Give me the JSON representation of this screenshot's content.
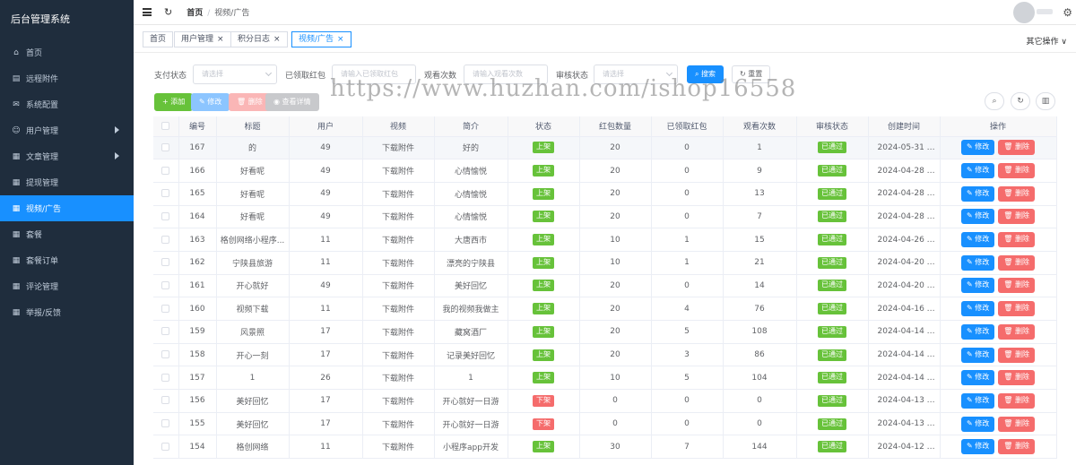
{
  "app": {
    "title": "后台管理系统"
  },
  "sidebar": {
    "items": [
      {
        "label": "首页",
        "icon": "home-icon",
        "arrow": false,
        "active": false
      },
      {
        "label": "远程附件",
        "icon": "file-icon",
        "arrow": false,
        "active": false
      },
      {
        "label": "系统配置",
        "icon": "chat-icon",
        "arrow": false,
        "active": false
      },
      {
        "label": "用户管理",
        "icon": "user-icon",
        "arrow": true,
        "active": false
      },
      {
        "label": "文章管理",
        "icon": "document-icon",
        "arrow": true,
        "active": false
      },
      {
        "label": "提现管理",
        "icon": "grid-icon",
        "arrow": false,
        "active": false
      },
      {
        "label": "视频/广告",
        "icon": "grid-icon",
        "arrow": false,
        "active": true
      },
      {
        "label": "套餐",
        "icon": "grid-icon",
        "arrow": false,
        "active": false
      },
      {
        "label": "套餐订单",
        "icon": "grid-icon",
        "arrow": false,
        "active": false
      },
      {
        "label": "评论管理",
        "icon": "grid-icon",
        "arrow": false,
        "active": false
      },
      {
        "label": "举报/反馈",
        "icon": "grid-icon",
        "arrow": false,
        "active": false
      }
    ]
  },
  "header": {
    "breadcrumb_home": "首页",
    "breadcrumb_sep": "/",
    "breadcrumb_current": "视频/广告"
  },
  "tags": [
    {
      "label": "首页",
      "closable": false,
      "active": false
    },
    {
      "label": "用户管理",
      "closable": true,
      "active": false
    },
    {
      "label": "积分日志",
      "closable": true,
      "active": false
    },
    {
      "label": "视频/广告",
      "closable": true,
      "active": true
    }
  ],
  "tags_other_ops": "其它操作 ∨",
  "search": {
    "pay_status_label": "支付状态",
    "pay_status_placeholder": "请选择",
    "redpacket_label": "已领取红包",
    "redpacket_placeholder": "请输入已领取红包",
    "views_label": "观看次数",
    "views_placeholder": "请输入观看次数",
    "audit_label": "审核状态",
    "audit_placeholder": "请选择",
    "search_btn": "搜索",
    "reset_btn": "重置"
  },
  "toolbar": {
    "add": "+ 添加",
    "edit": "修改",
    "delete": "删除",
    "detail": "查看详情"
  },
  "table": {
    "headers": [
      "",
      "编号",
      "标题",
      "用户",
      "视频",
      "简介",
      "状态",
      "红包数量",
      "已领取红包",
      "观看次数",
      "审核状态",
      "创建时间",
      "操作"
    ],
    "edit_label": "修改",
    "delete_label": "删除",
    "rows": [
      {
        "id": "167",
        "title": "的",
        "user": "49",
        "video": "下载附件",
        "intro": "好的",
        "status": "上架",
        "packets": "20",
        "received": "0",
        "views": "1",
        "audit": "已通过",
        "created": "2024-05-31 15:..."
      },
      {
        "id": "166",
        "title": "好看呢",
        "user": "49",
        "video": "下载附件",
        "intro": "心情愉悦",
        "status": "上架",
        "packets": "20",
        "received": "0",
        "views": "9",
        "audit": "已通过",
        "created": "2024-04-28 18:..."
      },
      {
        "id": "165",
        "title": "好看呢",
        "user": "49",
        "video": "下载附件",
        "intro": "心情愉悦",
        "status": "上架",
        "packets": "20",
        "received": "0",
        "views": "13",
        "audit": "已通过",
        "created": "2024-04-28 18:..."
      },
      {
        "id": "164",
        "title": "好看呢",
        "user": "49",
        "video": "下载附件",
        "intro": "心情愉悦",
        "status": "上架",
        "packets": "20",
        "received": "0",
        "views": "7",
        "audit": "已通过",
        "created": "2024-04-28 18:..."
      },
      {
        "id": "163",
        "title": "格创网络小程序...",
        "user": "11",
        "video": "下载附件",
        "intro": "大唐西市",
        "status": "上架",
        "packets": "10",
        "received": "1",
        "views": "15",
        "audit": "已通过",
        "created": "2024-04-26 00:..."
      },
      {
        "id": "162",
        "title": "宁陕县旅游",
        "user": "11",
        "video": "下载附件",
        "intro": "漂亮的宁陕县",
        "status": "上架",
        "packets": "10",
        "received": "1",
        "views": "21",
        "audit": "已通过",
        "created": "2024-04-20 22:..."
      },
      {
        "id": "161",
        "title": "开心就好",
        "user": "49",
        "video": "下载附件",
        "intro": "美好回忆",
        "status": "上架",
        "packets": "20",
        "received": "0",
        "views": "14",
        "audit": "已通过",
        "created": "2024-04-20 15:..."
      },
      {
        "id": "160",
        "title": "视频下载",
        "user": "11",
        "video": "下载附件",
        "intro": "我的视频我做主",
        "status": "上架",
        "packets": "20",
        "received": "4",
        "views": "76",
        "audit": "已通过",
        "created": "2024-04-16 22:..."
      },
      {
        "id": "159",
        "title": "风景照",
        "user": "17",
        "video": "下载附件",
        "intro": "藏窝酒厂",
        "status": "上架",
        "packets": "20",
        "received": "5",
        "views": "108",
        "audit": "已通过",
        "created": "2024-04-14 11:..."
      },
      {
        "id": "158",
        "title": "开心一刻",
        "user": "17",
        "video": "下载附件",
        "intro": "记录美好回忆",
        "status": "上架",
        "packets": "20",
        "received": "3",
        "views": "86",
        "audit": "已通过",
        "created": "2024-04-14 11:..."
      },
      {
        "id": "157",
        "title": "1",
        "user": "26",
        "video": "下载附件",
        "intro": "1",
        "status": "上架",
        "packets": "10",
        "received": "5",
        "views": "104",
        "audit": "已通过",
        "created": "2024-04-14 11:..."
      },
      {
        "id": "156",
        "title": "美好回忆",
        "user": "17",
        "video": "下载附件",
        "intro": "开心就好一日游",
        "status": "下架",
        "packets": "0",
        "received": "0",
        "views": "0",
        "audit": "已通过",
        "created": "2024-04-13 13:..."
      },
      {
        "id": "155",
        "title": "美好回忆",
        "user": "17",
        "video": "下载附件",
        "intro": "开心就好一日游",
        "status": "下架",
        "packets": "0",
        "received": "0",
        "views": "0",
        "audit": "已通过",
        "created": "2024-04-13 13:..."
      },
      {
        "id": "154",
        "title": "格创网络",
        "user": "11",
        "video": "下载附件",
        "intro": "小程序app开发",
        "status": "上架",
        "packets": "30",
        "received": "7",
        "views": "144",
        "audit": "已通过",
        "created": "2024-04-12 19:..."
      }
    ]
  },
  "watermark": "https://www.huzhan.com/ishop16558",
  "colors": {
    "sidebar_bg": "#1f2d3d",
    "primary": "#1890ff",
    "success": "#67c23a",
    "danger": "#f56c6c"
  }
}
